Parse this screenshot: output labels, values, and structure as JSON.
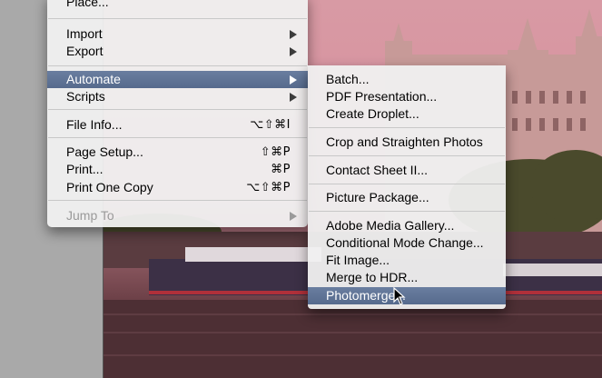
{
  "file_menu": {
    "items": [
      {
        "label": "Place...",
        "shortcut": "",
        "submenu": false,
        "state": "normal"
      },
      {
        "label": "Import",
        "shortcut": "",
        "submenu": true,
        "state": "normal"
      },
      {
        "label": "Export",
        "shortcut": "",
        "submenu": true,
        "state": "normal"
      },
      {
        "label": "Automate",
        "shortcut": "",
        "submenu": true,
        "state": "highlighted"
      },
      {
        "label": "Scripts",
        "shortcut": "",
        "submenu": true,
        "state": "normal"
      },
      {
        "label": "File Info...",
        "shortcut": "⌥⇧⌘I",
        "submenu": false,
        "state": "normal"
      },
      {
        "label": "Page Setup...",
        "shortcut": "⇧⌘P",
        "submenu": false,
        "state": "normal"
      },
      {
        "label": "Print...",
        "shortcut": "⌘P",
        "submenu": false,
        "state": "normal"
      },
      {
        "label": "Print One Copy",
        "shortcut": "⌥⇧⌘P",
        "submenu": false,
        "state": "normal"
      },
      {
        "label": "Jump To",
        "shortcut": "",
        "submenu": true,
        "state": "disabled"
      }
    ]
  },
  "automate_submenu": {
    "items": [
      {
        "label": "Batch...",
        "state": "normal"
      },
      {
        "label": "PDF Presentation...",
        "state": "normal"
      },
      {
        "label": "Create Droplet...",
        "state": "normal"
      },
      {
        "label": "Crop and Straighten Photos",
        "state": "normal"
      },
      {
        "label": "Contact Sheet II...",
        "state": "normal"
      },
      {
        "label": "Picture Package...",
        "state": "normal"
      },
      {
        "label": "Adobe Media Gallery...",
        "state": "normal"
      },
      {
        "label": "Conditional Mode Change...",
        "state": "normal"
      },
      {
        "label": "Fit Image...",
        "state": "normal"
      },
      {
        "label": "Merge to HDR...",
        "state": "normal"
      },
      {
        "label": "Photomerge...",
        "state": "highlighted"
      }
    ]
  },
  "colors": {
    "menu_background": "#f0f0f0",
    "highlight": "#5f7396",
    "disabled_text": "#9a9a9a",
    "photo_sky": "#d793a0"
  }
}
